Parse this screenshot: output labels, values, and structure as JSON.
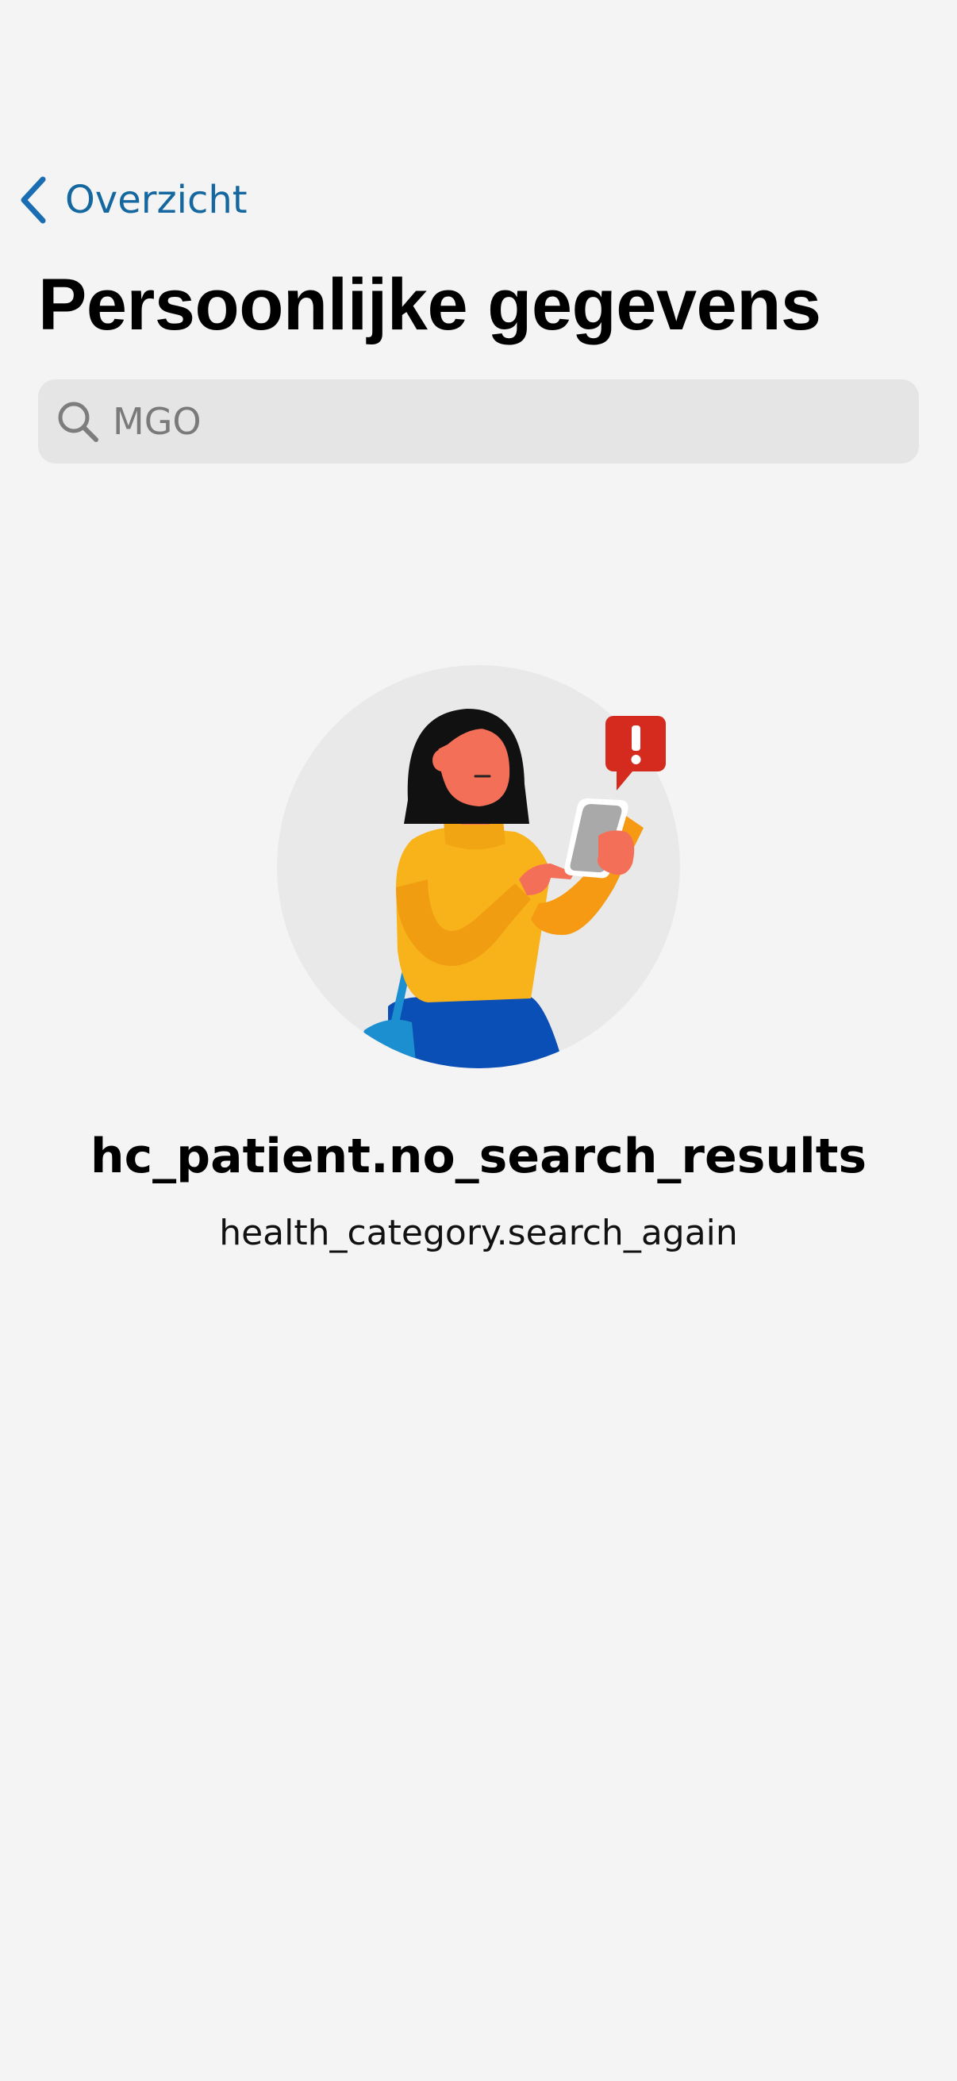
{
  "navigation": {
    "back_label": "Overzicht",
    "back_icon": "chevron-left-icon",
    "accent_color": "#15689f"
  },
  "header": {
    "title": "Persoonlijke gegevens"
  },
  "search": {
    "value": "MGO",
    "icon": "search-icon"
  },
  "empty_state": {
    "illustration": "woman-with-phone-alert-illustration",
    "title": "hc_patient.no_search_results",
    "subtitle": "health_category.search_again",
    "alert_color": "#d52b1e"
  }
}
